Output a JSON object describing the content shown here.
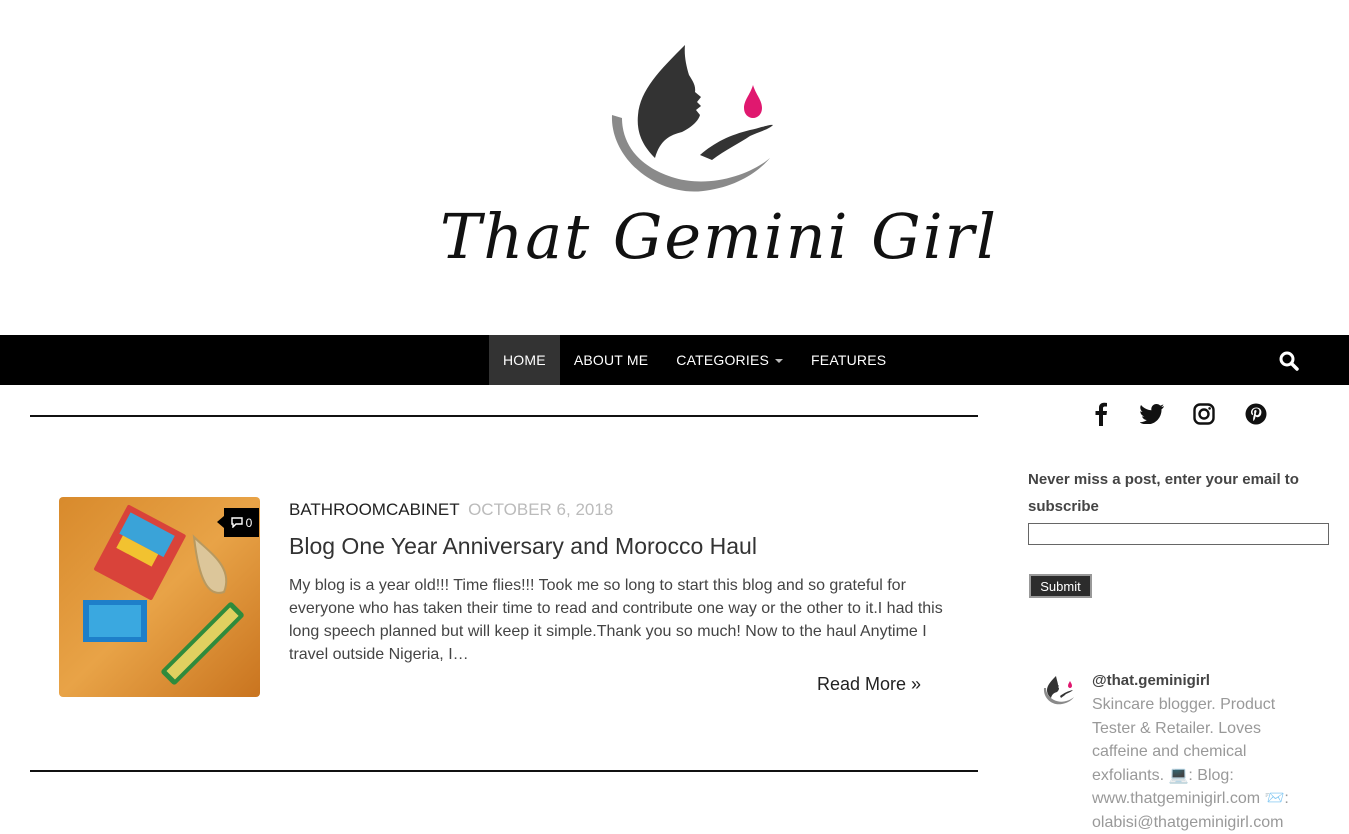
{
  "site": {
    "name": "That Gemini Girl",
    "logo_colors": {
      "dark": "#333333",
      "gray": "#8a8a8a",
      "accent": "#e0186f"
    }
  },
  "nav": {
    "items": [
      {
        "label": "HOME",
        "active": true
      },
      {
        "label": "ABOUT ME",
        "active": false
      },
      {
        "label": "CATEGORIES",
        "active": false,
        "has_dropdown": true
      },
      {
        "label": "FEATURES",
        "active": false
      }
    ],
    "search_icon": "search-icon",
    "background": "#000000"
  },
  "post": {
    "category": "BATHROOMCABINET",
    "date": "OCTOBER 6, 2018",
    "title": "Blog One Year Anniversary and Morocco Haul",
    "excerpt": "My blog is a year old!!! Time flies!!! Took me so long to start this blog and so grateful for everyone who has taken their time to read and contribute one way or the other to it.I had this long speech planned but will keep it simple.Thank you so much! Now to the haul Anytime I travel outside Nigeria, I…",
    "comment_count": "0",
    "read_more": "Read More »"
  },
  "sidebar": {
    "social": [
      "facebook-icon",
      "twitter-icon",
      "instagram-icon",
      "pinterest-icon"
    ],
    "subscribe": {
      "label": "Never miss a post, enter your email to subscribe",
      "input_value": "",
      "button": "Submit"
    },
    "instagram": {
      "handle": "@that.geminigirl",
      "bio_lines": [
        "Skincare blogger. Product",
        "Tester & Retailer. Loves",
        "caffeine and chemical",
        "exfoliants. 💻: Blog:",
        "www.thatgeminigirl.com 📨:",
        "olabisi@thatgeminigirl.com"
      ]
    }
  }
}
